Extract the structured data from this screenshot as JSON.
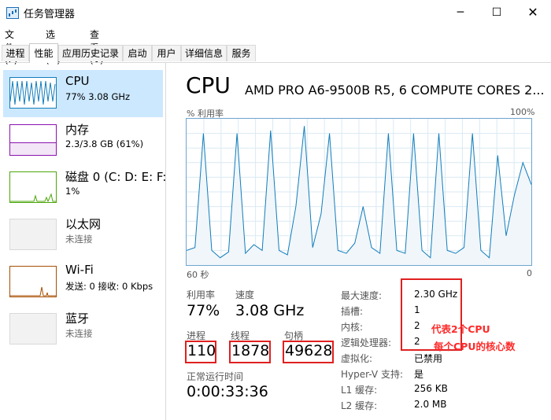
{
  "window": {
    "title": "任务管理器"
  },
  "menu": [
    "文件(F)",
    "选项(O)",
    "查看(V)"
  ],
  "tabs": [
    "进程",
    "性能",
    "应用历史记录",
    "启动",
    "用户",
    "详细信息",
    "服务"
  ],
  "resources": [
    {
      "name": "CPU",
      "detail": "77%  3.08 GHz"
    },
    {
      "name": "内存",
      "detail": "2.3/3.8 GB (61%)"
    },
    {
      "name": "磁盘 0 (C: D: E: F:",
      "detail": "1%"
    },
    {
      "name": "以太网",
      "detail": "未连接"
    },
    {
      "name": "Wi-Fi",
      "detail": "发送: 0  接收: 0 Kbps"
    },
    {
      "name": "蓝牙",
      "detail": "未连接"
    }
  ],
  "main": {
    "title": "CPU",
    "model": "AMD PRO A6-9500B R5, 6 COMPUTE CORES 2...",
    "graph": {
      "y_label": "% 利用率",
      "y_max": "100%",
      "x_left": "60 秒",
      "x_right": "0",
      "utilization_series": [
        10,
        12,
        90,
        10,
        5,
        9,
        90,
        8,
        14,
        10,
        92,
        10,
        7,
        40,
        95,
        12,
        35,
        90,
        10,
        8,
        15,
        40,
        12,
        8,
        90,
        10,
        8,
        90,
        10,
        5,
        90,
        10,
        8,
        12,
        90,
        10,
        5,
        75,
        20,
        48,
        70,
        55
      ]
    },
    "stats": {
      "util_label": "利用率",
      "util_value": "77%",
      "speed_label": "速度",
      "speed_value": "3.08 GHz",
      "proc_label": "进程",
      "proc_value": "110",
      "thread_label": "线程",
      "thread_value": "1878",
      "handle_label": "句柄",
      "handle_value": "49628",
      "uptime_label": "正常运行时间",
      "uptime_value": "0:00:33:36"
    },
    "details": [
      {
        "label": "最大速度:",
        "value": "2.30 GHz"
      },
      {
        "label": "插槽:",
        "value": "1"
      },
      {
        "label": "内核:",
        "value": "2"
      },
      {
        "label": "逻辑处理器:",
        "value": "2"
      },
      {
        "label": "虚拟化:",
        "value": "已禁用"
      },
      {
        "label": "Hyper-V 支持:",
        "value": "是"
      },
      {
        "label": "L1 缓存:",
        "value": "256 KB"
      },
      {
        "label": "L2 缓存:",
        "value": "2.0 MB"
      }
    ],
    "annotation": {
      "line1": "代表2个CPU",
      "line2": "每个CPU的核心数"
    }
  },
  "colors": {
    "accent": "#1b6db6",
    "selected": "#cce8ff",
    "cpu_line": "#117dbb",
    "mem": "#8b12ae",
    "disk": "#4da60c",
    "net": "#a74f01",
    "annotation": "#e02020"
  }
}
